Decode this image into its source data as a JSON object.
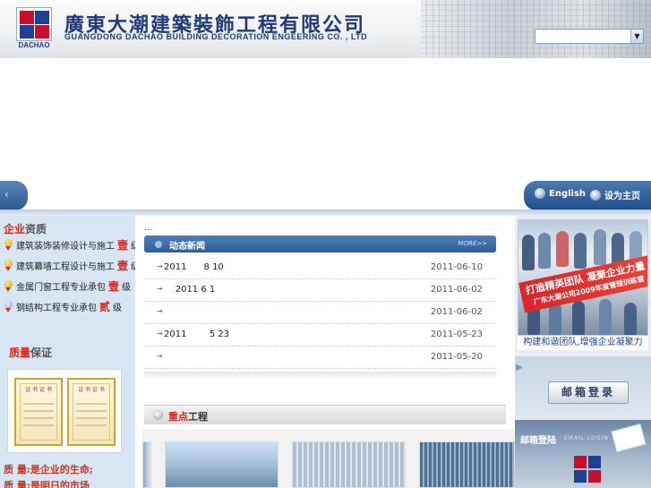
{
  "header": {
    "logo_text": "DACHAO",
    "title_cn": "廣東大潮建築裝飾工程有限公司",
    "title_en": "GUANGDONG DACHAO BUILDING DECORATION ENGEERING CO. , LTD",
    "select_value": ""
  },
  "nav": {
    "english_label": "English",
    "homepage_label": "设为主页"
  },
  "left": {
    "qualification_heading_red": "企业",
    "qualification_heading": "资质",
    "qualifications": [
      {
        "text": "建筑装饰装修设计与施工",
        "level": "壹",
        "suffix": "级"
      },
      {
        "text": "建筑幕墙工程设计与施工",
        "level": "壹",
        "suffix": "级"
      },
      {
        "text": "金属门窗工程专业承包",
        "level": "壹",
        "suffix": "级"
      },
      {
        "text": "钢结构工程专业承包",
        "level": "贰",
        "suffix": "级"
      }
    ],
    "quality_heading_red": "质量",
    "quality_heading": "保证",
    "cert_title": "证 书 证 书",
    "quotes": [
      "质 量:是企业的生命;",
      "质 量:是明日的市场"
    ]
  },
  "center": {
    "breadcrumb": "...",
    "news_tab": "动态新闻",
    "news_more": "MORE>>",
    "news": [
      {
        "title": "2011      8 10",
        "date": "2011-06-10"
      },
      {
        "title": "    2011 6 1",
        "date": "2011-06-02"
      },
      {
        "title": "",
        "date": "2011-06-02"
      },
      {
        "title": "2011        5 23",
        "date": "2011-05-23"
      },
      {
        "title": "",
        "date": "2011-05-20"
      }
    ],
    "projects_heading_red": "重点",
    "projects_heading": "工程"
  },
  "right": {
    "banner_line1": "打造精英团队  凝聚企业力量",
    "banner_line2": "广东大潮公司2009年度管理训练营",
    "photo_caption": "构建和谐团队,增强企业凝聚力",
    "mail_button": "邮箱登录",
    "mail_login_title": "邮箱登陆",
    "mail_login_sub": "EMAIL LOGIN"
  },
  "colors": {
    "brand_red": "#c8102e",
    "brand_blue": "#1f3f8f",
    "nav_blue": "#2a5a93",
    "left_panel": "#d8e6f3"
  }
}
